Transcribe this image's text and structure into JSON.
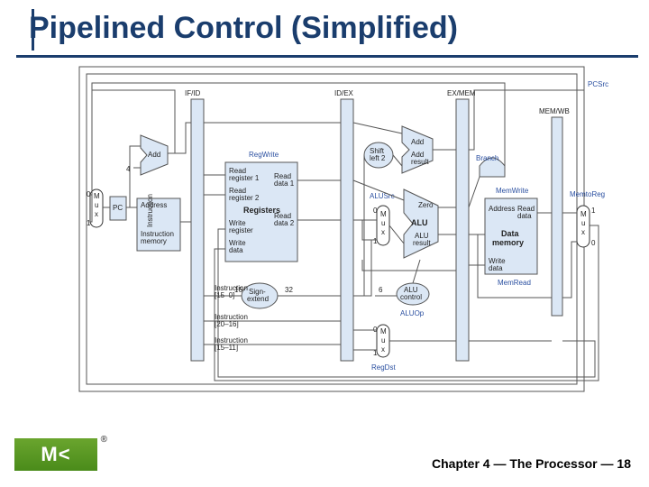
{
  "page": {
    "title": "Pipelined Control (Simplified)"
  },
  "footer": {
    "left": "Chapter 4 — The Processor —",
    "right": "18"
  },
  "pipeline_registers": [
    "IF/ID",
    "ID/EX",
    "EX/MEM",
    "MEM/WB"
  ],
  "signals": {
    "pcsrc": "PCSrc",
    "regwrite": "RegWrite",
    "alusrc": "ALUSrc",
    "aluop": "ALUOp",
    "regdst": "RegDst",
    "branch": "Branch",
    "memwrite": "MemWrite",
    "memread": "MemRead",
    "memtoreg": "MemtoReg"
  },
  "blocks": {
    "pc": "PC",
    "imem": "Instruction\nmemory",
    "address": "Address",
    "registers": "Registers",
    "rr1": "Read\nregister 1",
    "rr2": "Read\nregister 2",
    "wr": "Write\nregister",
    "wd": "Write\ndata",
    "rd1": "Read\ndata 1",
    "rd2": "Read\ndata 2",
    "signext": "Sign-\nextend",
    "shl2": "Shift\nleft 2",
    "alu": "ALU",
    "alures": "ALU\nresult",
    "zero": "Zero",
    "aluctrl": "ALU\ncontrol",
    "add1": "Add",
    "add2_top": "Add",
    "add2_bot": "Add\nresult",
    "dmem": "Data\nmemory",
    "daddr": "Address",
    "drd": "Read\ndata",
    "dwd": "Write\ndata",
    "mux": "M\nu\nx",
    "four": "4",
    "instr_15_0": "Instruction\n[15–0]",
    "instr_20_16": "Instruction\n[20–16]",
    "instr_15_11": "Instruction\n[15–11]",
    "w16": "16",
    "w32": "32",
    "six": "6",
    "instr_port": "Instruction"
  }
}
